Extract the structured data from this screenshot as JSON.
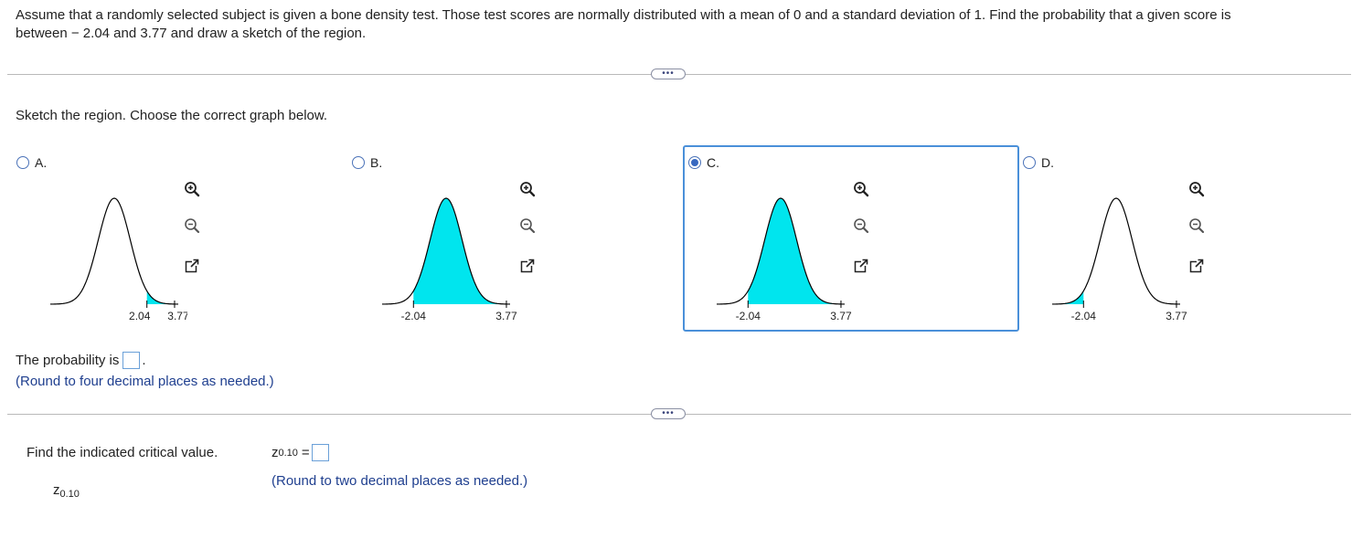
{
  "question": {
    "text_line1": "Assume that a randomly selected subject is given a bone density test. Those test scores are normally distributed with a mean of 0 and a standard deviation of 1. Find the probability that a given score is",
    "text_line2": "between  − 2.04 and 3.77 and draw a sketch of the region."
  },
  "expand_dots": "•••",
  "sketch_prompt": "Sketch the region. Choose the correct graph below.",
  "options": [
    {
      "letter": "A.",
      "selected": false,
      "tick_left": "2.04",
      "tick_right": "3.77",
      "shading": "right-tail"
    },
    {
      "letter": "B.",
      "selected": false,
      "tick_left": "-2.04",
      "tick_right": "3.77",
      "shading": "between"
    },
    {
      "letter": "C.",
      "selected": true,
      "tick_left": "-2.04",
      "tick_right": "3.77",
      "shading": "between"
    },
    {
      "letter": "D.",
      "selected": false,
      "tick_left": "-2.04",
      "tick_right": "3.77",
      "shading": "left-tail"
    }
  ],
  "tools": [
    "zoom-in-icon",
    "zoom-out-icon",
    "popout-icon"
  ],
  "probability": {
    "label": "The probability is",
    "period": ".",
    "hint": "(Round to four decimal places as needed.)"
  },
  "critical": {
    "prompt": "Find the indicated critical value.",
    "z_symbol": "z",
    "z_subscript": "0.10",
    "equals": "=",
    "hint": "(Round to two decimal places as needed.)"
  },
  "colors": {
    "shade": "#00e5ee",
    "accent": "#4a90d9",
    "hint_text": "#1f3f8f"
  }
}
